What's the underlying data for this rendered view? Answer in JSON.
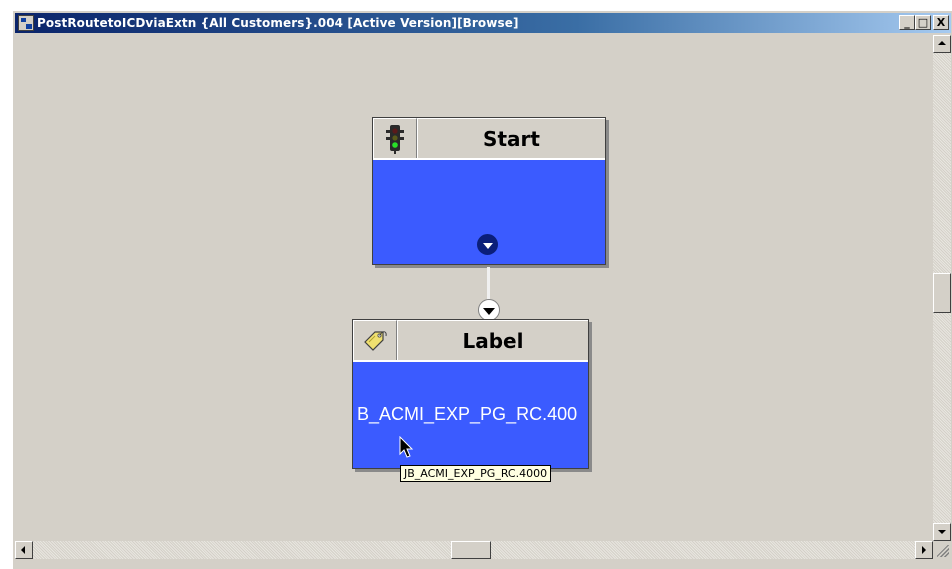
{
  "window": {
    "title": "PostRoutetoICDviaExtn {All Customers}.004 [Active Version][Browse]",
    "minimize_label": "_",
    "maximize_label": "□",
    "close_label": "X"
  },
  "nodes": {
    "start": {
      "title": "Start",
      "icon": "traffic-light-icon"
    },
    "label": {
      "title": "Label",
      "icon": "tag-icon",
      "value": "B_ACMI_EXP_PG_RC.400"
    }
  },
  "tooltip": {
    "text": "JB_ACMI_EXP_PG_RC.4000"
  },
  "colors": {
    "node_body": "#3b5bff",
    "canvas": "#d4d0c8",
    "titlebar_start": "#0a246a",
    "tooltip_bg": "#ffffe1"
  }
}
